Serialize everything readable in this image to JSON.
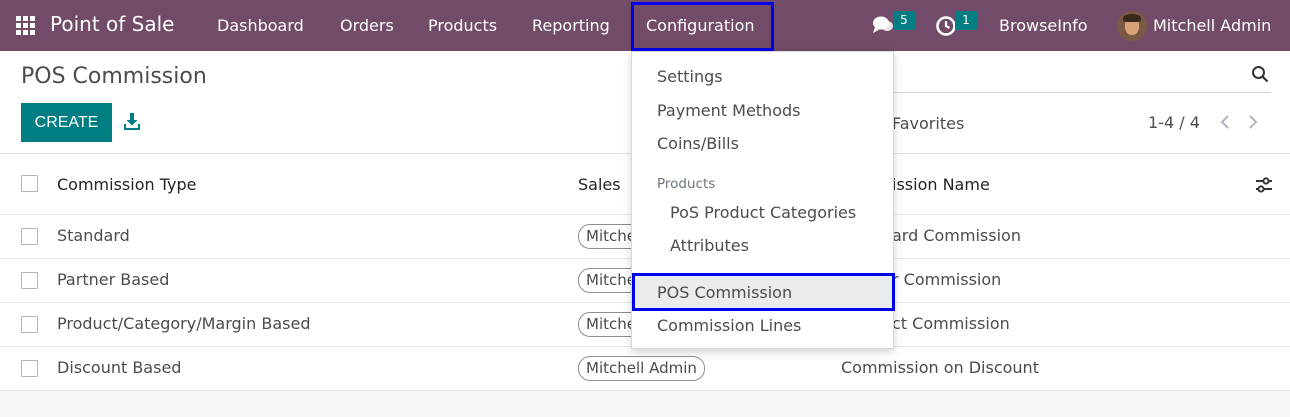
{
  "navbar": {
    "app_name": "Point of Sale",
    "menu": [
      "Dashboard",
      "Orders",
      "Products",
      "Reporting",
      "Configuration"
    ],
    "messages_count": "5",
    "activities_count": "1",
    "company": "BrowseInfo",
    "user": "Mitchell Admin",
    "color": "#714b67"
  },
  "control_panel": {
    "title": "POS Commission",
    "create_label": "CREATE",
    "favorites_label": "Favorites",
    "pager": "1-4 / 4",
    "accent": "#017e84"
  },
  "list": {
    "columns": [
      "Commission Type",
      "Sales",
      "ission Name"
    ],
    "rows": [
      {
        "type": "Standard",
        "sales": "Mitche",
        "name": "ard Commission"
      },
      {
        "type": "Partner Based",
        "sales": "Mitche",
        "name": "r Commission"
      },
      {
        "type": "Product/Category/Margin Based",
        "sales": "Mitche",
        "name": "ct Commission"
      },
      {
        "type": "Discount Based",
        "sales": "Mitchell Admin",
        "name": "Commission on Discount"
      }
    ]
  },
  "dropdown": {
    "items": [
      "Settings",
      "Payment Methods",
      "Coins/Bills"
    ],
    "section_header": "Products",
    "sub_items": [
      "PoS Product Categories",
      "Attributes"
    ],
    "commission_items": [
      "POS Commission",
      "Commission Lines"
    ],
    "highlight_color": "#0000e6"
  }
}
